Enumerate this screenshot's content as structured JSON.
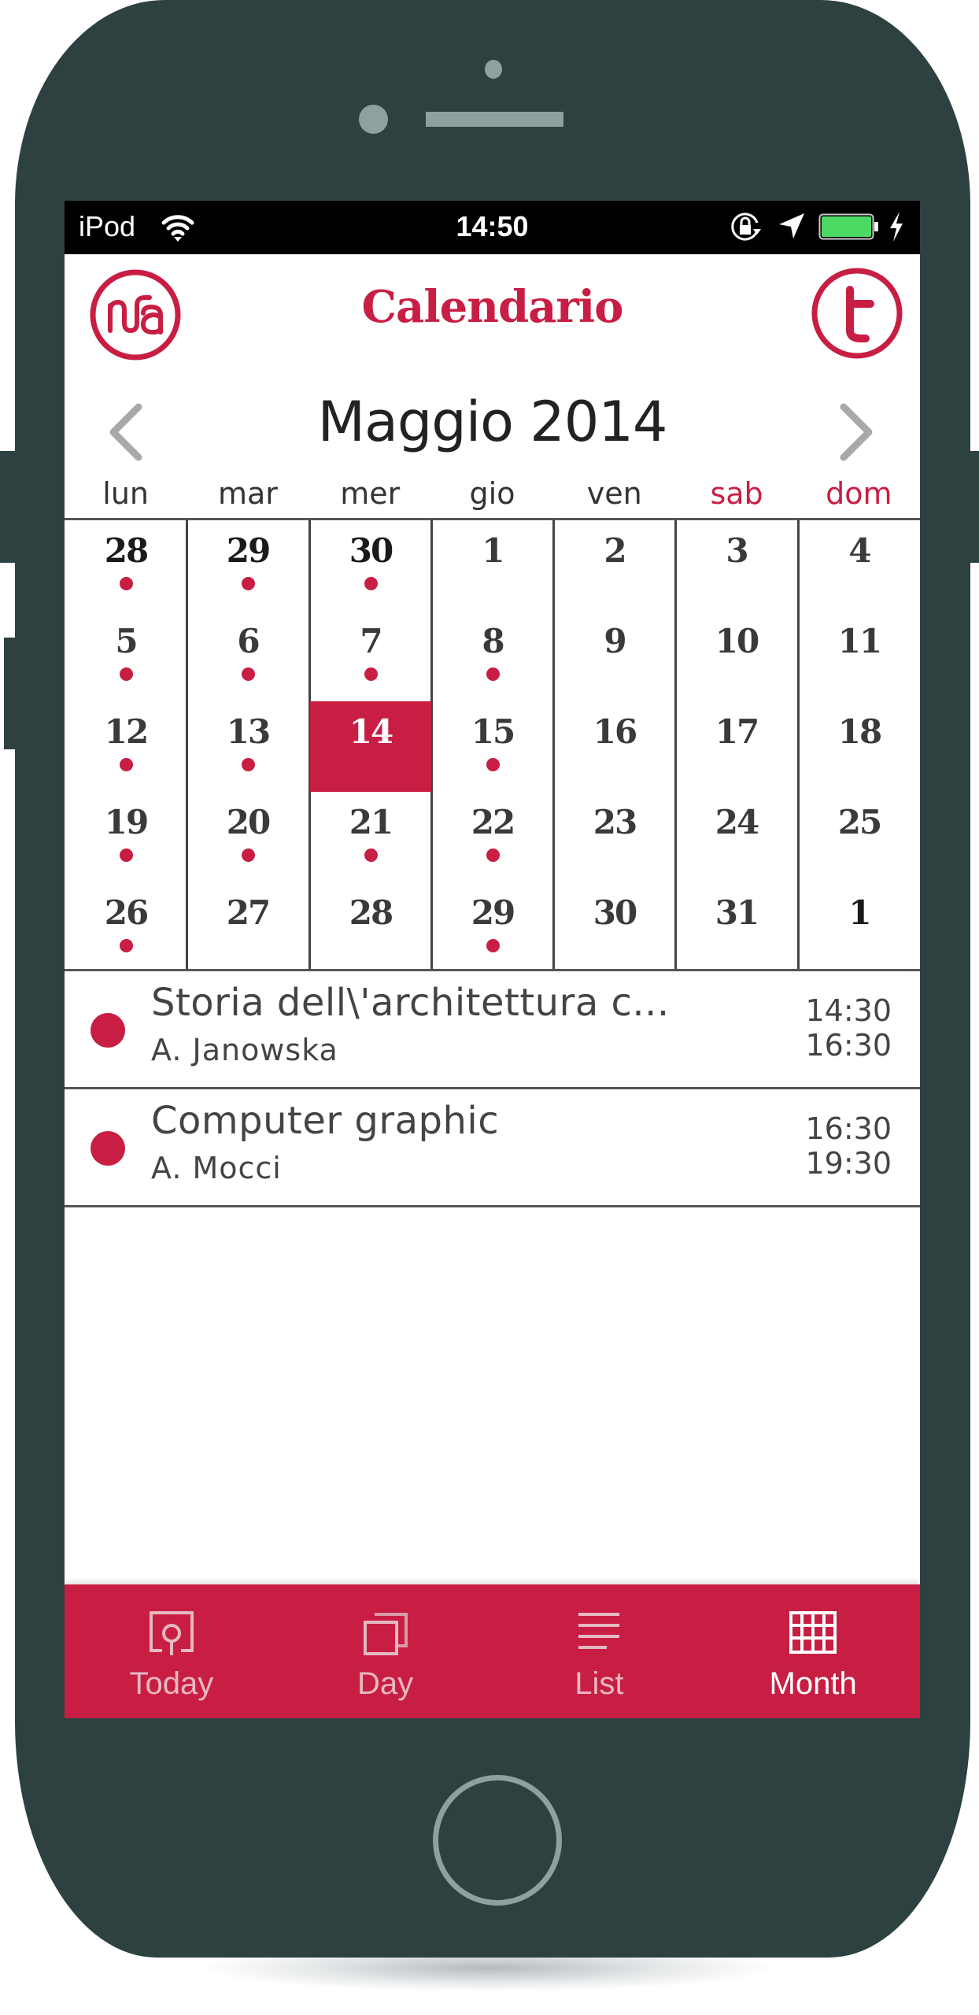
{
  "status_bar": {
    "carrier": "iPod",
    "time": "14:50",
    "icons": [
      "wifi-icon",
      "orientation-lock-icon",
      "location-arrow-icon",
      "battery-icon",
      "charging-bolt-icon"
    ],
    "battery_color": "#4cd964"
  },
  "header": {
    "title": "Calendario",
    "left_logo": "nfa-logo",
    "right_logo": "t-logo",
    "accent_color": "#c81e43"
  },
  "month_nav": {
    "title": "Maggio 2014",
    "prev_icon": "chevron-left-icon",
    "next_icon": "chevron-right-icon"
  },
  "weekdays": [
    {
      "label": "lun",
      "weekend": false
    },
    {
      "label": "mar",
      "weekend": false
    },
    {
      "label": "mer",
      "weekend": false
    },
    {
      "label": "gio",
      "weekend": false
    },
    {
      "label": "ven",
      "weekend": false
    },
    {
      "label": "sab",
      "weekend": true
    },
    {
      "label": "dom",
      "weekend": true
    }
  ],
  "calendar": {
    "selected_day": "14",
    "weeks": [
      [
        {
          "day": "28",
          "other": true,
          "event": true
        },
        {
          "day": "29",
          "other": true,
          "event": true
        },
        {
          "day": "30",
          "other": true,
          "event": true
        },
        {
          "day": "1",
          "event": false
        },
        {
          "day": "2",
          "event": false
        },
        {
          "day": "3",
          "event": false
        },
        {
          "day": "4",
          "event": false
        }
      ],
      [
        {
          "day": "5",
          "event": true
        },
        {
          "day": "6",
          "event": true
        },
        {
          "day": "7",
          "event": true
        },
        {
          "day": "8",
          "event": true
        },
        {
          "day": "9",
          "event": false
        },
        {
          "day": "10",
          "event": false
        },
        {
          "day": "11",
          "event": false
        }
      ],
      [
        {
          "day": "12",
          "event": true
        },
        {
          "day": "13",
          "event": true
        },
        {
          "day": "14",
          "event": true,
          "selected": true
        },
        {
          "day": "15",
          "event": true
        },
        {
          "day": "16",
          "event": false
        },
        {
          "day": "17",
          "event": false
        },
        {
          "day": "18",
          "event": false
        }
      ],
      [
        {
          "day": "19",
          "event": true
        },
        {
          "day": "20",
          "event": true
        },
        {
          "day": "21",
          "event": true
        },
        {
          "day": "22",
          "event": true
        },
        {
          "day": "23",
          "event": false
        },
        {
          "day": "24",
          "event": false
        },
        {
          "day": "25",
          "event": false
        }
      ],
      [
        {
          "day": "26",
          "event": true
        },
        {
          "day": "27",
          "event": false
        },
        {
          "day": "28",
          "event": false
        },
        {
          "day": "29",
          "event": true
        },
        {
          "day": "30",
          "event": false
        },
        {
          "day": "31",
          "event": false
        },
        {
          "day": "1",
          "other": true,
          "event": false
        }
      ]
    ]
  },
  "events": [
    {
      "title": "Storia dell\\'architettura c...",
      "person": "A. Janowska",
      "start": "14:30",
      "end": "16:30"
    },
    {
      "title": "Computer graphic",
      "person": "A. Mocci",
      "start": "16:30",
      "end": "19:30"
    }
  ],
  "tabbar": {
    "active": "Month",
    "tabs": [
      {
        "label": "Today",
        "icon": "today-icon",
        "active": false
      },
      {
        "label": "Day",
        "icon": "day-icon",
        "active": false
      },
      {
        "label": "List",
        "icon": "list-icon",
        "active": false
      },
      {
        "label": "Month",
        "icon": "month-grid-icon",
        "active": true
      }
    ]
  }
}
